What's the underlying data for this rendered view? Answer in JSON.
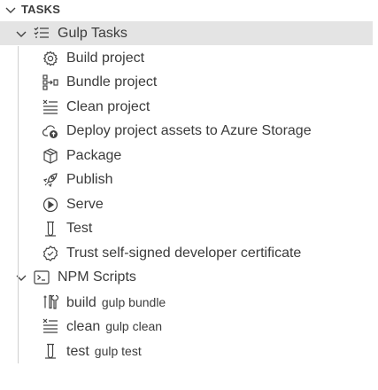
{
  "section": {
    "title": "TASKS"
  },
  "groups": {
    "gulp": {
      "label": "Gulp Tasks",
      "items": [
        {
          "label": "Build project",
          "icon": "gear-icon"
        },
        {
          "label": "Bundle project",
          "icon": "bundle-icon"
        },
        {
          "label": "Clean project",
          "icon": "clear-list-icon"
        },
        {
          "label": "Deploy project assets to Azure Storage",
          "icon": "cloud-upload-icon"
        },
        {
          "label": "Package",
          "icon": "package-icon"
        },
        {
          "label": "Publish",
          "icon": "rocket-icon"
        },
        {
          "label": "Serve",
          "icon": "play-circle-icon"
        },
        {
          "label": "Test",
          "icon": "beaker-icon"
        },
        {
          "label": "Trust self-signed developer certificate",
          "icon": "verified-icon"
        }
      ]
    },
    "npm": {
      "label": "NPM Scripts",
      "items": [
        {
          "label": "build",
          "description": "gulp bundle",
          "icon": "tools-icon"
        },
        {
          "label": "clean",
          "description": "gulp clean",
          "icon": "clear-list-icon"
        },
        {
          "label": "test",
          "description": "gulp test",
          "icon": "beaker-icon"
        }
      ]
    }
  },
  "colors": {
    "selected_row": "#e4e4e4",
    "text": "#3b3b3b",
    "icon": "#424242"
  }
}
